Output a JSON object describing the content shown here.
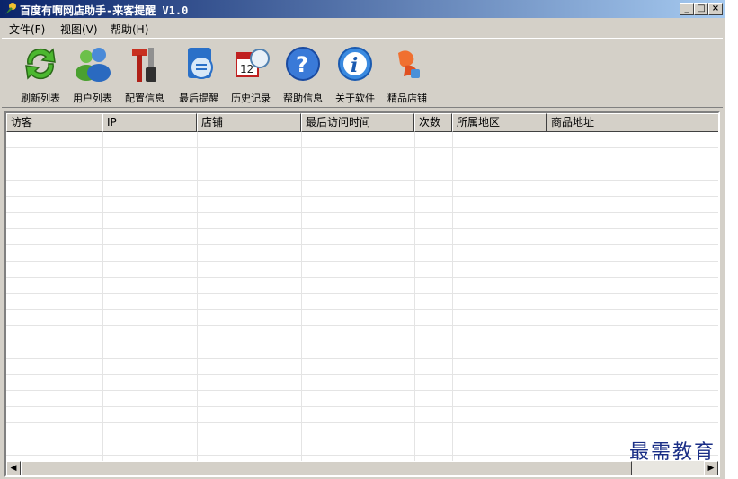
{
  "window": {
    "title": "百度有啊网店助手-来客提醒 V1.0"
  },
  "caption_buttons": {
    "minimize": "_",
    "maximize": "□",
    "close": "×"
  },
  "menu": [
    {
      "label": "文件(F)"
    },
    {
      "label": "视图(V)"
    },
    {
      "label": "帮助(H)"
    }
  ],
  "toolbar": [
    {
      "label": "刷新列表",
      "icon": "refresh-icon"
    },
    {
      "label": "用户列表",
      "icon": "users-icon"
    },
    {
      "label": "配置信息",
      "icon": "tools-icon"
    },
    {
      "label": "最后提醒",
      "icon": "reminder-icon"
    },
    {
      "label": "历史记录",
      "icon": "calendar-icon"
    },
    {
      "label": "帮助信息",
      "icon": "help-icon"
    },
    {
      "label": "关于软件",
      "icon": "info-icon"
    },
    {
      "label": "精品店铺",
      "icon": "taobao-icon"
    }
  ],
  "list": {
    "columns": [
      "访客",
      "IP",
      "店铺",
      "最后访问时间",
      "次数",
      "所属地区",
      "商品地址"
    ],
    "rows": []
  },
  "scrollbar": {
    "left_arrow": "◀",
    "right_arrow": "▶"
  },
  "watermark": "最需教育",
  "colors": {
    "titlebar_start": "#0a246a",
    "titlebar_end": "#a6caf0",
    "window_bg": "#d4d0c8",
    "watermark": "#1a2e86"
  }
}
